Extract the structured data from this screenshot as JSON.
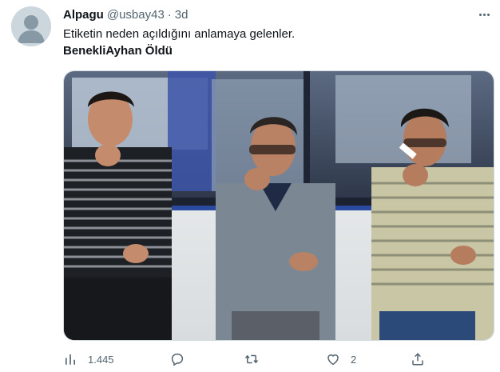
{
  "tweet": {
    "author": {
      "display_name": "Alpagu",
      "handle": "@usbay43",
      "separator": "·",
      "time": "3d",
      "avatar_icon": "default-avatar-icon"
    },
    "text_line1": "Etiketin neden açıldığını anlamaya gelenler.",
    "text_line2": "BenekliAyhan Öldü",
    "media": {
      "description_icon": "photo-three-men-bus"
    },
    "actions": {
      "views": {
        "icon": "bar-chart-icon",
        "count": "1.445"
      },
      "reply": {
        "icon": "reply-icon",
        "count": ""
      },
      "retweet": {
        "icon": "retweet-icon",
        "count": ""
      },
      "like": {
        "icon": "heart-icon",
        "count": "2"
      },
      "share": {
        "icon": "share-icon",
        "count": ""
      }
    },
    "more_icon": "more-icon"
  },
  "colors": {
    "text_primary": "#0f1419",
    "text_secondary": "#536471",
    "border": "#cfd9de",
    "avatar_bg": "#cfd9de"
  }
}
